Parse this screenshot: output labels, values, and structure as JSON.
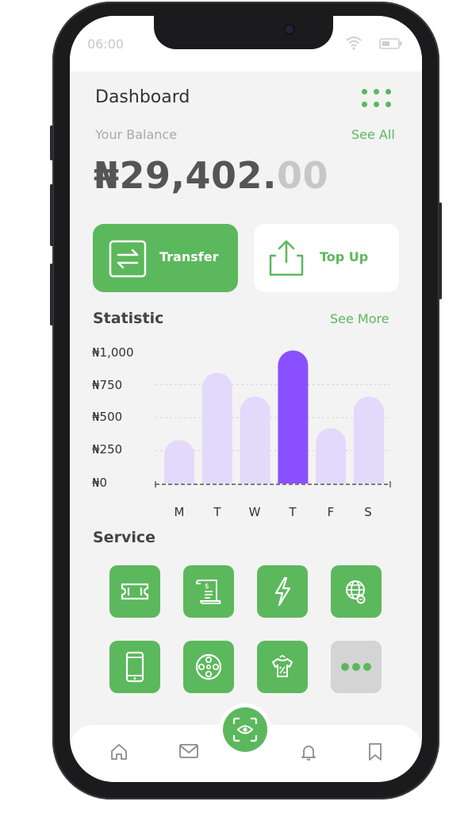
{
  "status_bar": {
    "time": "06:00"
  },
  "header": {
    "title": "Dashboard"
  },
  "balance": {
    "label": "Your Balance",
    "see_all": "See All",
    "amount_main": "₦29,402.",
    "amount_cents": "00"
  },
  "actions": {
    "transfer_label": "Transfer",
    "topup_label": "Top Up"
  },
  "statistic": {
    "title": "Statistic",
    "see_more": "See More"
  },
  "chart_data": {
    "type": "bar",
    "categories": [
      "M",
      "T",
      "W",
      "T",
      "F",
      "S"
    ],
    "values": [
      330,
      840,
      660,
      1010,
      420,
      660
    ],
    "highlight_index": 3,
    "y_ticks": [
      "₦1,000",
      "₦750",
      "₦500",
      "₦250",
      "₦0"
    ],
    "ylim": [
      0,
      1000
    ],
    "grid": true,
    "colors": {
      "bar": "#e3d9fb",
      "highlight": "#8a4fff"
    }
  },
  "service": {
    "title": "Service",
    "items": [
      {
        "icon": "ticket-icon"
      },
      {
        "icon": "receipt-icon"
      },
      {
        "icon": "lightning-icon"
      },
      {
        "icon": "internet-globe-icon"
      },
      {
        "icon": "smartphone-icon"
      },
      {
        "icon": "film-reel-icon"
      },
      {
        "icon": "laundry-shirt-icon"
      },
      {
        "icon": "more-icon"
      }
    ]
  },
  "nav": {
    "items": [
      "home-icon",
      "mail-icon",
      "scan-eye-icon",
      "bell-icon",
      "bookmark-icon"
    ]
  },
  "colors": {
    "accent": "#5cb85c",
    "bar": "#e3d9fb",
    "bar_highlight": "#8a4fff",
    "background": "#f3f3f3"
  }
}
